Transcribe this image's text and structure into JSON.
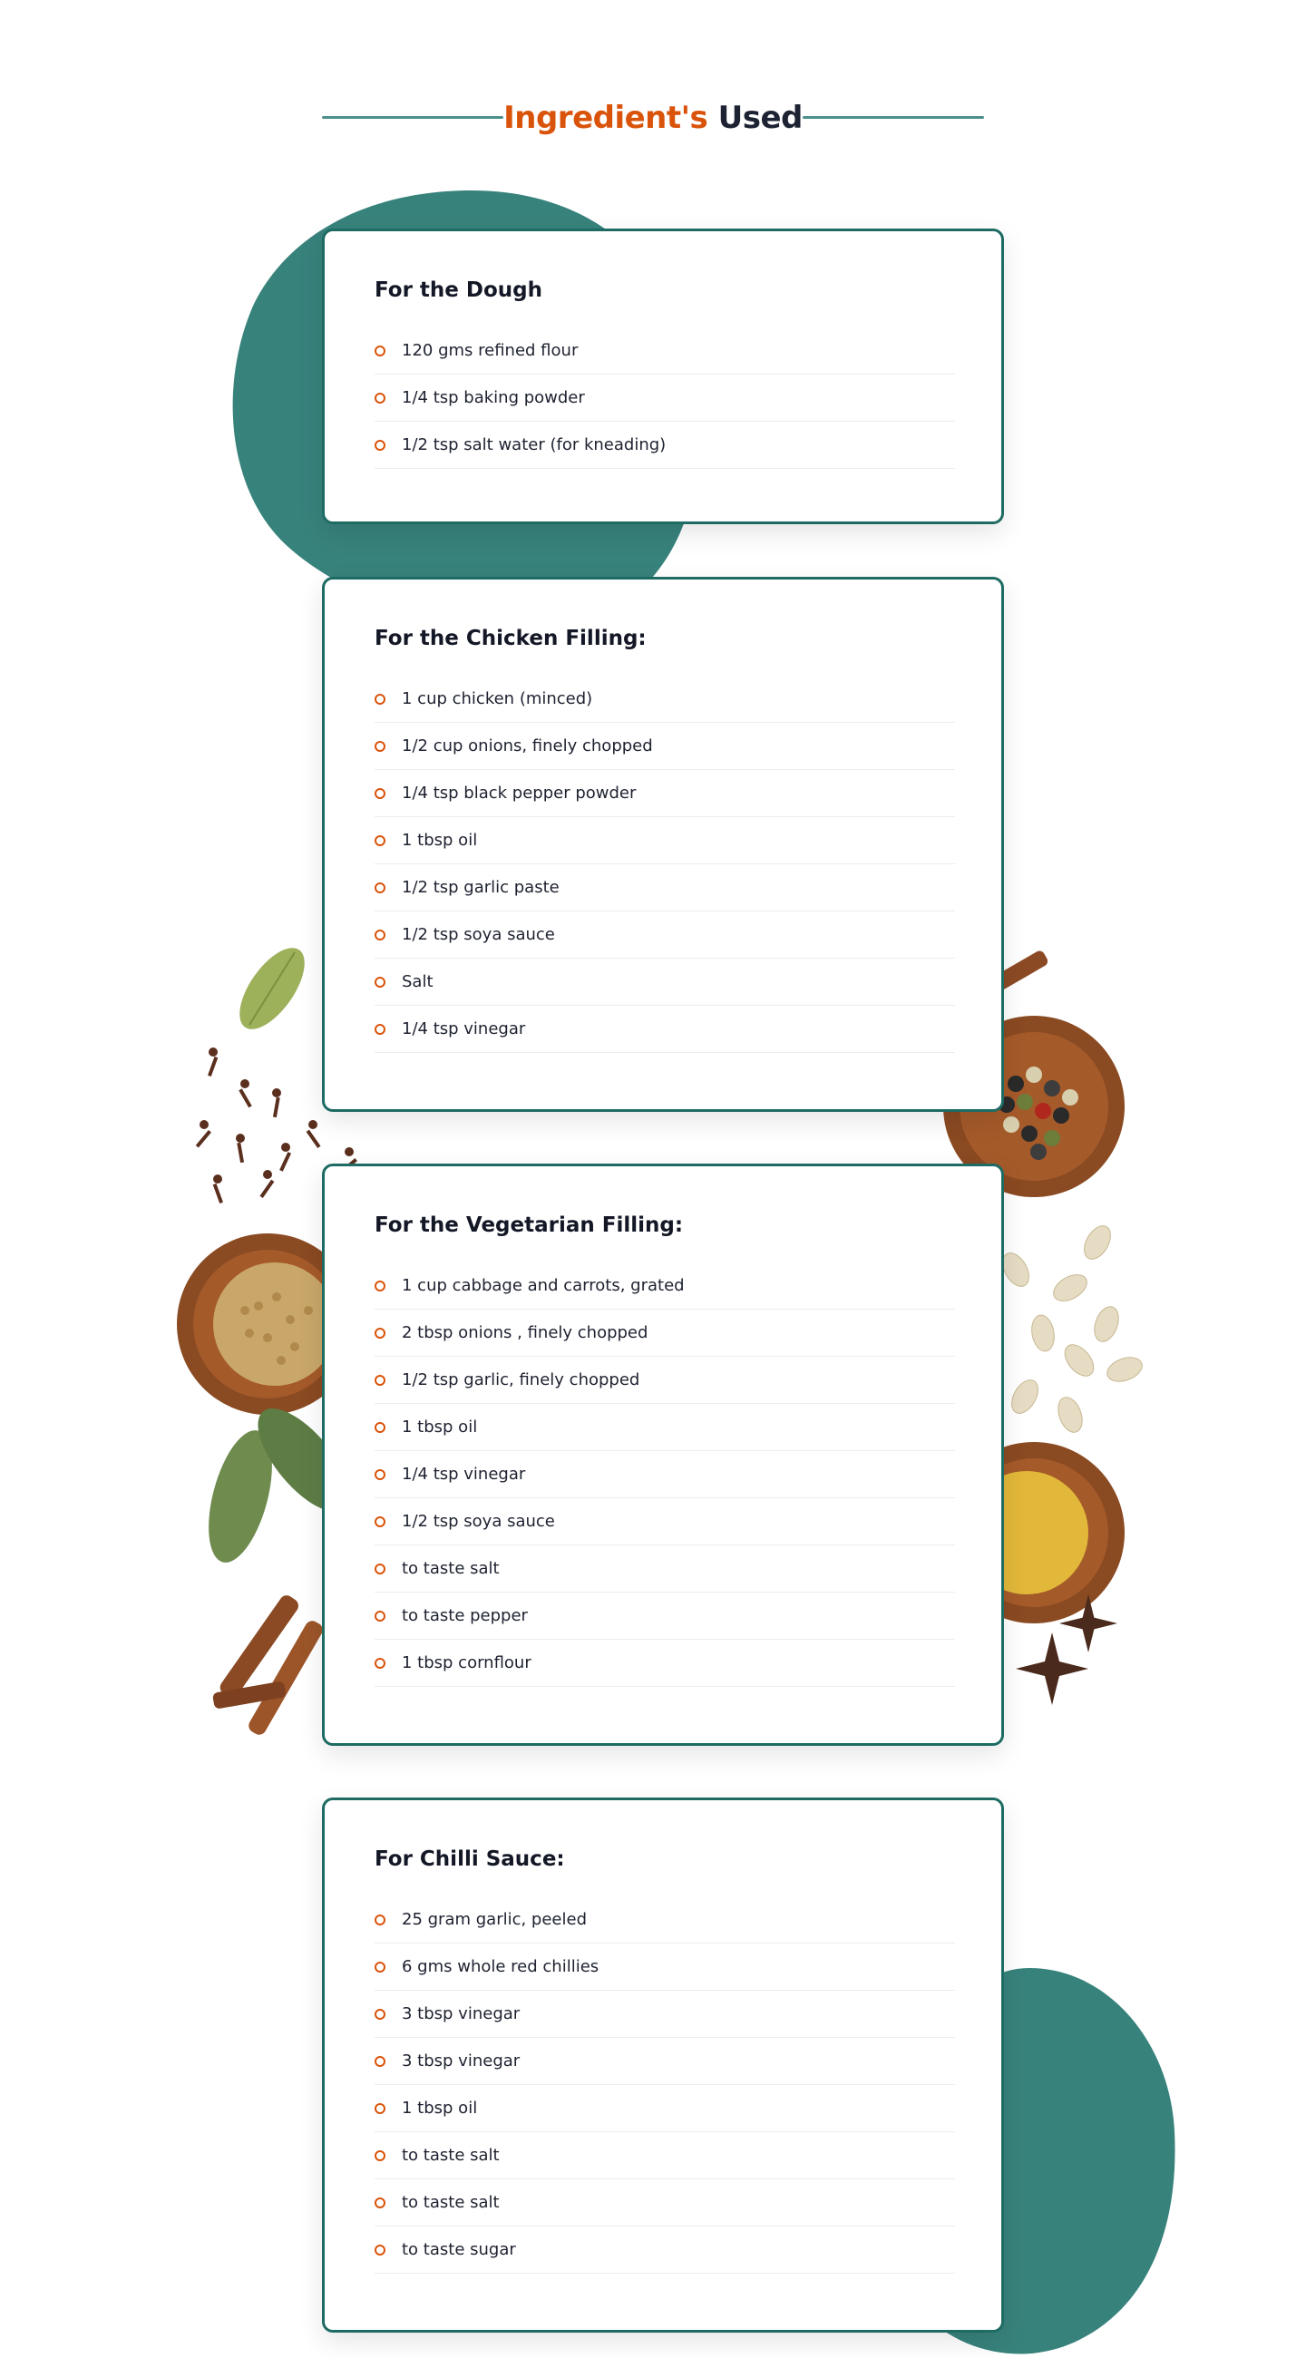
{
  "heading": {
    "part1": "Ingredient's",
    "part2": "Used"
  },
  "colors": {
    "accent": "#d9530b",
    "teal": "#2d7b75",
    "border": "#1d6b63"
  },
  "sections": [
    {
      "title": "For the Dough",
      "items": [
        "120 gms refined flour",
        "1/4 tsp baking powder",
        "1/2 tsp salt water (for kneading)"
      ]
    },
    {
      "title": "For the Chicken Filling:",
      "items": [
        "1 cup chicken (minced)",
        "1/2 cup onions, finely chopped",
        "1/4 tsp black pepper powder",
        "1 tbsp oil",
        "1/2 tsp garlic paste",
        "1/2 tsp soya sauce",
        "Salt",
        "1/4 tsp vinegar"
      ]
    },
    {
      "title": "For the Vegetarian Filling:",
      "items": [
        "1 cup cabbage and carrots, grated",
        "2 tbsp onions , finely chopped",
        "1/2 tsp garlic, finely chopped",
        "1 tbsp oil",
        "1/4 tsp vinegar",
        "1/2 tsp soya sauce",
        "to taste salt",
        "to taste pepper",
        "1 tbsp cornflour"
      ]
    },
    {
      "title": "For Chilli Sauce:",
      "items": [
        "25 gram garlic, peeled",
        "6 gms whole red chillies",
        "3 tbsp vinegar",
        "3 tbsp vinegar",
        "1 tbsp oil",
        "to taste salt",
        "to taste salt",
        "to taste sugar"
      ]
    }
  ]
}
